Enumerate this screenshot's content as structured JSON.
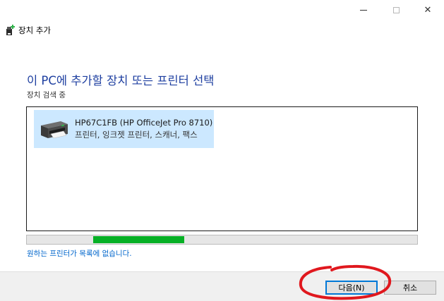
{
  "window": {
    "title": "장치 추가",
    "caption_buttons": {
      "minimize": "minimize-icon",
      "maximize": "maximize-icon",
      "close": "✕"
    }
  },
  "main": {
    "heading": "이 PC에 추가할 장치 또는 프린터 선택",
    "status": "장치 검색 중"
  },
  "devices": [
    {
      "name": "HP67C1FB (HP OfficeJet Pro 8710)",
      "category": "프린터, 잉크젯 프린터, 스캐너, 팩스",
      "icon": "printer-icon",
      "selected": true
    }
  ],
  "progress": {
    "indeterminate": true,
    "segment_start": 0.17,
    "segment_end": 0.403,
    "color": "#06b025"
  },
  "links": {
    "not_listed": "원하는 프린터가 목록에 없습니다."
  },
  "footer": {
    "next_label": "다음(N)",
    "cancel_label": "취소"
  },
  "colors": {
    "heading": "#1e3fa0",
    "link": "#0066cc",
    "selection": "#cce8ff",
    "annotation": "#e0181e"
  }
}
